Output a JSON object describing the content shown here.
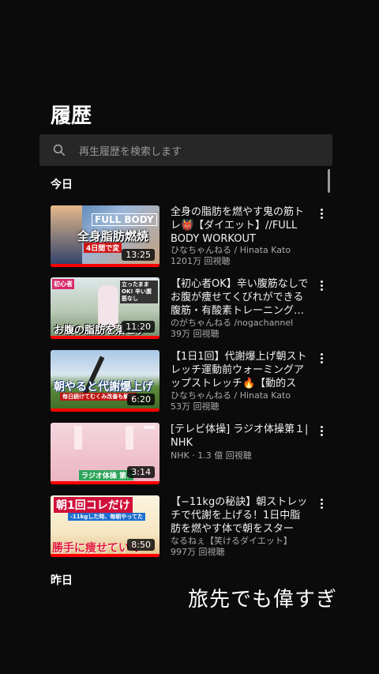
{
  "page_title": "履歴",
  "search": {
    "placeholder": "再生履歴を検索します",
    "icon": "search-icon"
  },
  "sections": {
    "today": "今日",
    "yesterday": "昨日"
  },
  "videos": [
    {
      "title": "全身の脂肪を燃やす鬼の筋トレ👹【ダイエット】//FULL BODY WORKOUT",
      "channel": "ひなちゃんねる / Hinata Kato",
      "views": "1201万 回視聴",
      "duration": "13:25",
      "thumb_text": "全身脂肪燃焼",
      "thumb_text2": "FULL BODY",
      "thumb_text3": "4日間で変"
    },
    {
      "title": "【初心者OK】辛い腹筋なしでお腹が痩せてくびれができる腹筋・有酸素トレーニング…",
      "channel": "のがちゃんねる /nogachannel",
      "views": "39万 回視聴",
      "duration": "11:20",
      "thumb_text": "お腹の脂肪を落とす",
      "thumb_text2": "立ったままOK! 辛い腹筋なし",
      "thumb_text3": "初心者"
    },
    {
      "title": "【1日1回】代謝爆上げ朝ストレッチ運動前ウォーミングアップストレッチ🔥【動的スト…",
      "channel": "ひなちゃんねる / Hinata Kato",
      "views": "53万 回視聴",
      "duration": "6:20",
      "thumb_text": "朝やると代謝爆上げ",
      "thumb_text2": "毎日続けてむくみ改善も解消"
    },
    {
      "title": "[テレビ体操] ラジオ体操第１| NHK",
      "channel": "NHK · 1.3 億 回視聴",
      "views": "",
      "duration": "3:14",
      "thumb_text": "ラジオ体操 第1",
      "thumb_text2": "NHK"
    },
    {
      "title": "【−11kgの秘訣】朝ストレッチで代謝を上げる！1日中脂肪を燃やす体で朝をスタート…",
      "channel": "なるねぇ【笑けるダイエット】",
      "views": "997万 回視聴",
      "duration": "8:50",
      "thumb_text": "朝1回コレだけ",
      "thumb_text2": "勝手に痩せていく",
      "thumb_text3": "-11kgした時、毎朝やってた"
    }
  ],
  "caption": "旅先でも偉すぎ"
}
